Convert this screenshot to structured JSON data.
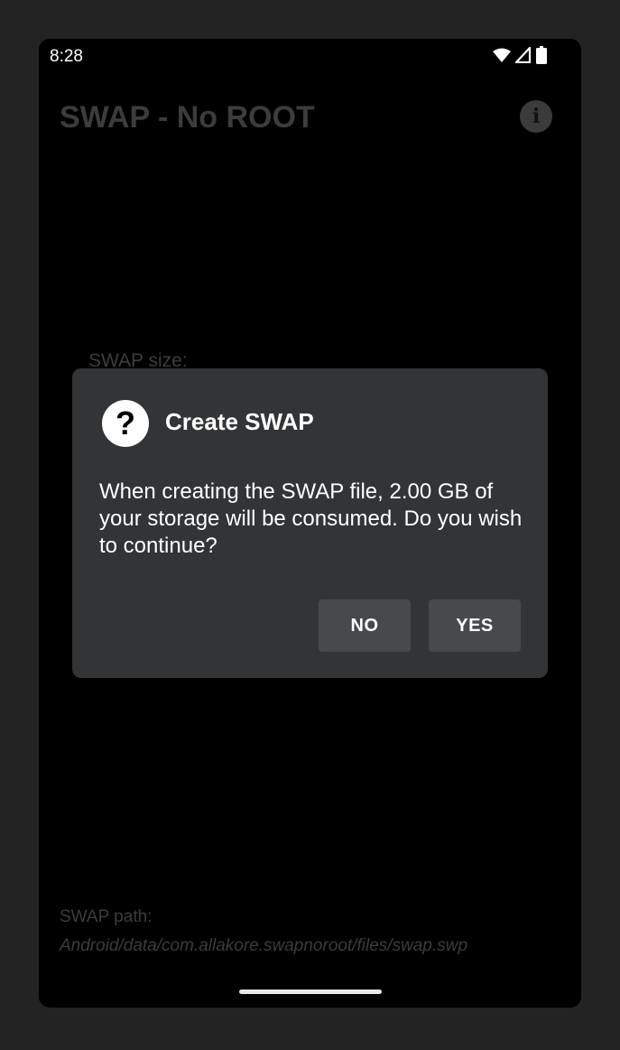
{
  "status_bar": {
    "time": "8:28",
    "icons": [
      "wifi-icon",
      "signal-icon",
      "battery-icon"
    ]
  },
  "app_bar": {
    "title": "SWAP - No ROOT",
    "info_icon": "i"
  },
  "main": {
    "swap_size_label": "SWAP size:",
    "swap_path_label": "SWAP path:",
    "swap_path_value": "Android/data/com.allakore.swapnoroot/files/swap.swp"
  },
  "dialog": {
    "icon": "?",
    "title": "Create SWAP",
    "message": "When creating the SWAP file, 2.00 GB of your storage will be consumed. Do you wish to continue?",
    "no_label": "NO",
    "yes_label": "YES"
  },
  "colors": {
    "background": "#232323",
    "screen": "#000000",
    "dialog": "#323436",
    "button": "#47494b",
    "dimmed_text": "#3c3c3c"
  }
}
